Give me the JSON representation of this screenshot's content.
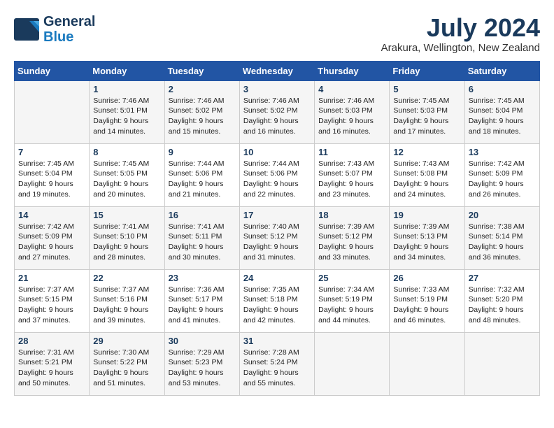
{
  "header": {
    "logo_line1": "General",
    "logo_line2": "Blue",
    "month_year": "July 2024",
    "location": "Arakura, Wellington, New Zealand"
  },
  "days_of_week": [
    "Sunday",
    "Monday",
    "Tuesday",
    "Wednesday",
    "Thursday",
    "Friday",
    "Saturday"
  ],
  "weeks": [
    [
      {
        "day": "",
        "info": ""
      },
      {
        "day": "1",
        "info": "Sunrise: 7:46 AM\nSunset: 5:01 PM\nDaylight: 9 hours\nand 14 minutes."
      },
      {
        "day": "2",
        "info": "Sunrise: 7:46 AM\nSunset: 5:02 PM\nDaylight: 9 hours\nand 15 minutes."
      },
      {
        "day": "3",
        "info": "Sunrise: 7:46 AM\nSunset: 5:02 PM\nDaylight: 9 hours\nand 16 minutes."
      },
      {
        "day": "4",
        "info": "Sunrise: 7:46 AM\nSunset: 5:03 PM\nDaylight: 9 hours\nand 16 minutes."
      },
      {
        "day": "5",
        "info": "Sunrise: 7:45 AM\nSunset: 5:03 PM\nDaylight: 9 hours\nand 17 minutes."
      },
      {
        "day": "6",
        "info": "Sunrise: 7:45 AM\nSunset: 5:04 PM\nDaylight: 9 hours\nand 18 minutes."
      }
    ],
    [
      {
        "day": "7",
        "info": "Sunrise: 7:45 AM\nSunset: 5:04 PM\nDaylight: 9 hours\nand 19 minutes."
      },
      {
        "day": "8",
        "info": "Sunrise: 7:45 AM\nSunset: 5:05 PM\nDaylight: 9 hours\nand 20 minutes."
      },
      {
        "day": "9",
        "info": "Sunrise: 7:44 AM\nSunset: 5:06 PM\nDaylight: 9 hours\nand 21 minutes."
      },
      {
        "day": "10",
        "info": "Sunrise: 7:44 AM\nSunset: 5:06 PM\nDaylight: 9 hours\nand 22 minutes."
      },
      {
        "day": "11",
        "info": "Sunrise: 7:43 AM\nSunset: 5:07 PM\nDaylight: 9 hours\nand 23 minutes."
      },
      {
        "day": "12",
        "info": "Sunrise: 7:43 AM\nSunset: 5:08 PM\nDaylight: 9 hours\nand 24 minutes."
      },
      {
        "day": "13",
        "info": "Sunrise: 7:42 AM\nSunset: 5:09 PM\nDaylight: 9 hours\nand 26 minutes."
      }
    ],
    [
      {
        "day": "14",
        "info": "Sunrise: 7:42 AM\nSunset: 5:09 PM\nDaylight: 9 hours\nand 27 minutes."
      },
      {
        "day": "15",
        "info": "Sunrise: 7:41 AM\nSunset: 5:10 PM\nDaylight: 9 hours\nand 28 minutes."
      },
      {
        "day": "16",
        "info": "Sunrise: 7:41 AM\nSunset: 5:11 PM\nDaylight: 9 hours\nand 30 minutes."
      },
      {
        "day": "17",
        "info": "Sunrise: 7:40 AM\nSunset: 5:12 PM\nDaylight: 9 hours\nand 31 minutes."
      },
      {
        "day": "18",
        "info": "Sunrise: 7:39 AM\nSunset: 5:12 PM\nDaylight: 9 hours\nand 33 minutes."
      },
      {
        "day": "19",
        "info": "Sunrise: 7:39 AM\nSunset: 5:13 PM\nDaylight: 9 hours\nand 34 minutes."
      },
      {
        "day": "20",
        "info": "Sunrise: 7:38 AM\nSunset: 5:14 PM\nDaylight: 9 hours\nand 36 minutes."
      }
    ],
    [
      {
        "day": "21",
        "info": "Sunrise: 7:37 AM\nSunset: 5:15 PM\nDaylight: 9 hours\nand 37 minutes."
      },
      {
        "day": "22",
        "info": "Sunrise: 7:37 AM\nSunset: 5:16 PM\nDaylight: 9 hours\nand 39 minutes."
      },
      {
        "day": "23",
        "info": "Sunrise: 7:36 AM\nSunset: 5:17 PM\nDaylight: 9 hours\nand 41 minutes."
      },
      {
        "day": "24",
        "info": "Sunrise: 7:35 AM\nSunset: 5:18 PM\nDaylight: 9 hours\nand 42 minutes."
      },
      {
        "day": "25",
        "info": "Sunrise: 7:34 AM\nSunset: 5:19 PM\nDaylight: 9 hours\nand 44 minutes."
      },
      {
        "day": "26",
        "info": "Sunrise: 7:33 AM\nSunset: 5:19 PM\nDaylight: 9 hours\nand 46 minutes."
      },
      {
        "day": "27",
        "info": "Sunrise: 7:32 AM\nSunset: 5:20 PM\nDaylight: 9 hours\nand 48 minutes."
      }
    ],
    [
      {
        "day": "28",
        "info": "Sunrise: 7:31 AM\nSunset: 5:21 PM\nDaylight: 9 hours\nand 50 minutes."
      },
      {
        "day": "29",
        "info": "Sunrise: 7:30 AM\nSunset: 5:22 PM\nDaylight: 9 hours\nand 51 minutes."
      },
      {
        "day": "30",
        "info": "Sunrise: 7:29 AM\nSunset: 5:23 PM\nDaylight: 9 hours\nand 53 minutes."
      },
      {
        "day": "31",
        "info": "Sunrise: 7:28 AM\nSunset: 5:24 PM\nDaylight: 9 hours\nand 55 minutes."
      },
      {
        "day": "",
        "info": ""
      },
      {
        "day": "",
        "info": ""
      },
      {
        "day": "",
        "info": ""
      }
    ]
  ]
}
